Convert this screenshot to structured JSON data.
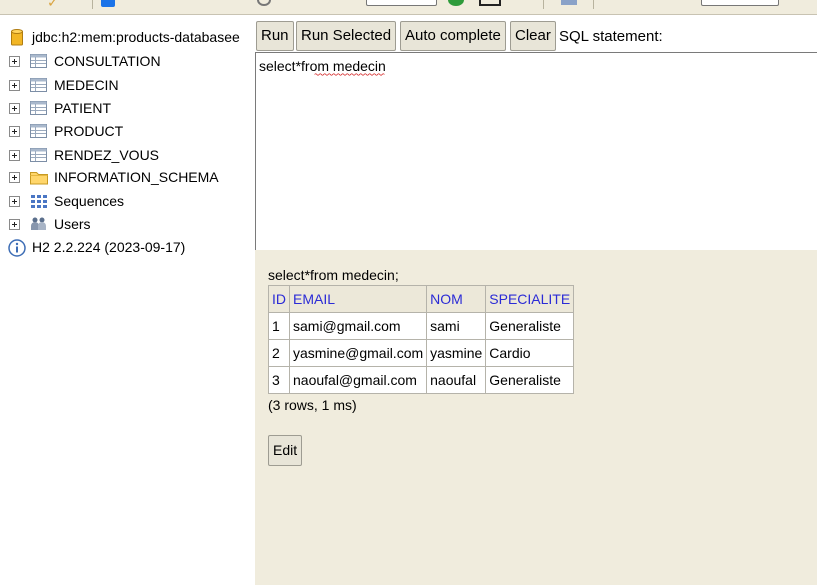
{
  "colors": {
    "panel_bg": "#f0ecdd",
    "header_text": "#2b2bd6",
    "button_bg": "#e8e5d8",
    "squiggle": "#d32020"
  },
  "tree": {
    "connection": "jdbc:h2:mem:products-databasee",
    "connection_icon": "database-icon",
    "items": [
      {
        "label": "CONSULTATION",
        "icon": "table-icon"
      },
      {
        "label": "MEDECIN",
        "icon": "table-icon"
      },
      {
        "label": "PATIENT",
        "icon": "table-icon"
      },
      {
        "label": "PRODUCT",
        "icon": "table-icon"
      },
      {
        "label": "RENDEZ_VOUS",
        "icon": "table-icon"
      },
      {
        "label": "INFORMATION_SCHEMA",
        "icon": "folder-icon"
      },
      {
        "label": "Sequences",
        "icon": "sequences-icon"
      },
      {
        "label": "Users",
        "icon": "users-icon"
      }
    ],
    "version": "H2 2.2.224 (2023-09-17)"
  },
  "query_bar": {
    "run": "Run",
    "run_selected": "Run Selected",
    "auto_complete": "Auto complete",
    "clear": "Clear",
    "sql_label": "SQL statement:"
  },
  "editor": {
    "text": "select*from medecin"
  },
  "results": {
    "statement": "select*from medecin;",
    "columns": [
      "ID",
      "EMAIL",
      "NOM",
      "SPECIALITE"
    ],
    "rows": [
      [
        "1",
        "sami@gmail.com",
        "sami",
        "Generaliste"
      ],
      [
        "2",
        "yasmine@gmail.com",
        "yasmine",
        "Cardio"
      ],
      [
        "3",
        "naoufal@gmail.com",
        "naoufal",
        "Generaliste"
      ]
    ],
    "summary": "(3 rows, 1 ms)",
    "edit_label": "Edit"
  }
}
